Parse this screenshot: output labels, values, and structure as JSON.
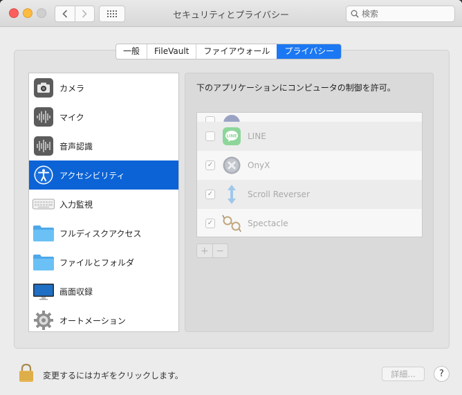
{
  "window": {
    "title": "セキュリティとプライバシー"
  },
  "toolbar": {
    "back_icon": "chevron-left-icon",
    "forward_icon": "chevron-right-icon",
    "grid_icon": "grid-icon",
    "search_placeholder": "検索"
  },
  "tabs": [
    {
      "label": "一般",
      "active": false
    },
    {
      "label": "FileVault",
      "active": false
    },
    {
      "label": "ファイアウォール",
      "active": false
    },
    {
      "label": "プライバシー",
      "active": true
    }
  ],
  "categories": [
    {
      "label": "カメラ",
      "icon": "camera-icon"
    },
    {
      "label": "マイク",
      "icon": "microphone-waveform-icon"
    },
    {
      "label": "音声認識",
      "icon": "speech-waveform-icon"
    },
    {
      "label": "アクセシビリティ",
      "icon": "accessibility-icon",
      "selected": true
    },
    {
      "label": "入力監視",
      "icon": "keyboard-icon"
    },
    {
      "label": "フルディスクアクセス",
      "icon": "folder-icon"
    },
    {
      "label": "ファイルとフォルダ",
      "icon": "folder-icon"
    },
    {
      "label": "画面収録",
      "icon": "display-icon"
    },
    {
      "label": "オートメーション",
      "icon": "gear-icon"
    }
  ],
  "detail": {
    "heading": "下のアプリケーションにコンピュータの制御を許可。",
    "apps": [
      {
        "name": "LINE",
        "checked": false,
        "icon": "line-app-icon"
      },
      {
        "name": "OnyX",
        "checked": true,
        "icon": "onyx-app-icon"
      },
      {
        "name": "Scroll Reverser",
        "checked": true,
        "icon": "scroll-reverser-app-icon"
      },
      {
        "name": "Spectacle",
        "checked": true,
        "icon": "spectacle-app-icon"
      }
    ],
    "add_label": "+",
    "remove_label": "−"
  },
  "footer": {
    "lock_icon": "lock-icon",
    "lock_text": "変更するにはカギをクリックします。",
    "advanced_label": "詳細...",
    "help_label": "?"
  },
  "colors": {
    "accent": "#1b78f2",
    "selection": "#0b63d6"
  }
}
